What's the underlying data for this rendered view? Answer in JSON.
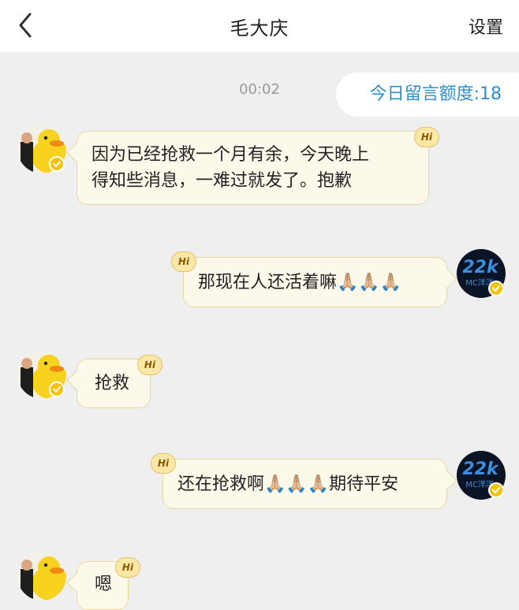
{
  "header": {
    "title": "毛大庆",
    "settings_label": "设置",
    "back_icon": "chevron-left-icon"
  },
  "quota": {
    "label": "今日留言额度:18"
  },
  "timestamp": "00:02",
  "badge_text": "Hi",
  "self_avatar_text": "MC洋洋",
  "messages": [
    {
      "side": "left",
      "text": "因为已经抢救一个月有余，今天晚上\n得知些消息，一难过就发了。抱歉"
    },
    {
      "side": "right",
      "text": "那现在人还活着嘛🙏🏼🙏🏼🙏🏼"
    },
    {
      "side": "left",
      "text": "抢救"
    },
    {
      "side": "right",
      "text": "还在抢救啊🙏🏼🙏🏼🙏🏼期待平安"
    },
    {
      "side": "left",
      "text": "嗯"
    }
  ],
  "colors": {
    "background": "#efefef",
    "bubble_fill": "#fdf9ea",
    "bubble_border": "#e9d7a2",
    "quota_text": "#2f8fd0",
    "verified_badge": "#f4c20d"
  }
}
